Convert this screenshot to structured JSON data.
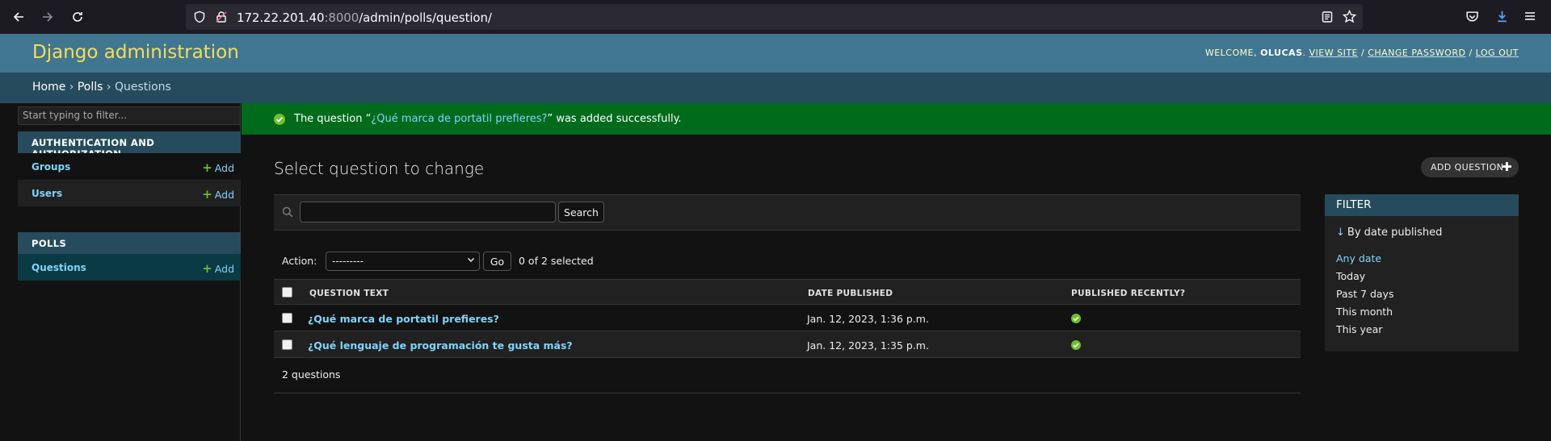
{
  "browser": {
    "url_host": "172.22.201.40",
    "url_port": ":8000",
    "url_path": "/admin/polls/question/"
  },
  "header": {
    "brand": "Django administration",
    "welcome": "WELCOME,",
    "username": "OLUCAS",
    "view_site": "VIEW SITE",
    "change_password": "CHANGE PASSWORD",
    "log_out": "LOG OUT"
  },
  "breadcrumbs": {
    "home": "Home",
    "polls": "Polls",
    "current": "Questions"
  },
  "sidebar": {
    "filter_placeholder": "Start typing to filter...",
    "auth_caption": "AUTHENTICATION AND AUTHORIZATION",
    "polls_caption": "POLLS",
    "add_label": "Add",
    "models": [
      {
        "name": "Groups"
      },
      {
        "name": "Users"
      },
      {
        "name": "Questions"
      }
    ]
  },
  "message": {
    "prefix": "The question “",
    "question": "¿Qué marca de portatil prefieres?",
    "suffix": "” was added successfully."
  },
  "main": {
    "title": "Select question to change",
    "add_button": "ADD QUESTION",
    "search_button": "Search",
    "action_label": "Action:",
    "action_value": "---------",
    "go_button": "Go",
    "selected_count": "0 of 2 selected",
    "columns": [
      "QUESTION TEXT",
      "DATE PUBLISHED",
      "PUBLISHED RECENTLY?"
    ],
    "rows": [
      {
        "question": "¿Qué marca de portatil prefieres?",
        "date": "Jan. 12, 2023, 1:36 p.m."
      },
      {
        "question": "¿Qué lenguaje de programación te gusta más?",
        "date": "Jan. 12, 2023, 1:35 p.m."
      }
    ],
    "paginator": "2 questions"
  },
  "filter": {
    "title": "FILTER",
    "subtitle": "By date published",
    "options": [
      "Any date",
      "Today",
      "Past 7 days",
      "This month",
      "This year"
    ]
  },
  "colors": {
    "header": "#417690",
    "breadcrumbs": "#264b5d",
    "success": "#006b1b",
    "link": "#81d4fa",
    "brand": "#f5dd5d"
  }
}
